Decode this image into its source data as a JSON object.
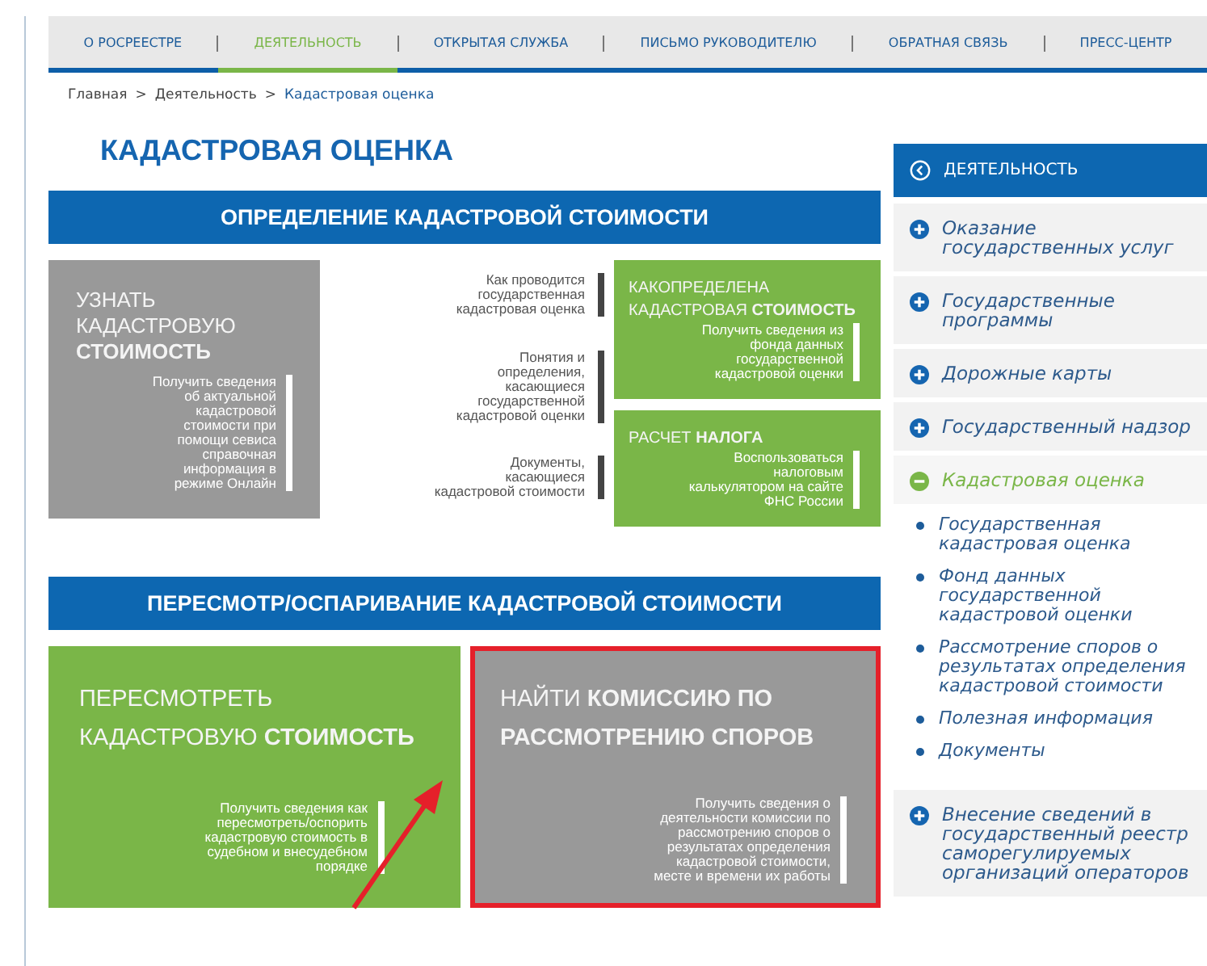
{
  "nav": [
    {
      "label": "О РОСРЕЕСТРЕ",
      "selected": false
    },
    {
      "label": "ДЕЯТЕЛЬНОСТЬ",
      "selected": true
    },
    {
      "label": "ОТКРЫТАЯ СЛУЖБА",
      "selected": false
    },
    {
      "label": "ПИСЬМО РУКОВОДИТЕЛЮ",
      "selected": false
    },
    {
      "label": "ОБРАТНАЯ СВЯЗЬ",
      "selected": false
    },
    {
      "label": "ПРЕСС-ЦЕНТР",
      "selected": false
    }
  ],
  "breadcrumbs": [
    {
      "label": "Главная",
      "current": false
    },
    {
      "label": "Деятельность",
      "current": false
    },
    {
      "label": "Кадастровая оценка",
      "current": true
    }
  ],
  "breadcrumb_separators": [
    ">",
    ">"
  ],
  "page_title": "КАДАСТРОВАЯ ОЦЕНКА",
  "sections": [
    {
      "banner": "ОПРЕДЕЛЕНИЕ КАДАСТРОВОЙ СТОИМОСТИ",
      "cards": [
        {
          "kind": "tile",
          "color": "#999999",
          "highlighted": false,
          "title": [
            "УЗНАТЬ",
            "КАДАСТРОВУЮ",
            "**СТОИМОСТЬ**"
          ],
          "description": "Получить сведения об актуальной кадастровой стоимости при помощи севиса справочная информация в режиме Онлайн"
        },
        {
          "kind": "links",
          "links": [
            "Как проводится государственная кадастровая оценка",
            "Понятия и определения, касающиеся государственной кадастровой оценки",
            "Документы, касающиеся кадастровой стоимости"
          ]
        },
        {
          "kind": "stack",
          "tiles": [
            {
              "kind": "tile",
              "color": "#7ab648",
              "highlighted": false,
              "title": [
                "КАКОПРЕДЕЛЕНА",
                "КАДАСТРОВАЯ **СТОИМОСТЬ**"
              ],
              "description": "Получить сведения из фонда данных государственной кадастровой оценки"
            },
            {
              "kind": "tile",
              "color": "#7ab648",
              "highlighted": false,
              "title": [
                "РАСЧЕТ **НАЛОГА**"
              ],
              "description": "Воспользоваться налоговым калькулятором на сайте ФНС России"
            }
          ]
        }
      ]
    },
    {
      "banner": "ПЕРЕСМОТР/ОСПАРИВАНИЕ КАДАСТРОВОЙ СТОИМОСТИ",
      "cards": [
        {
          "kind": "tile",
          "color": "#7ab648",
          "highlighted": false,
          "title": [
            "ПЕРЕСМОТРЕТЬ",
            "КАДАСТРОВУЮ **СТОИМОСТЬ**"
          ],
          "description": "Получить сведения как пересмотреть/оспорить кадастровую стоимость в судебном и внесудебном порядке"
        },
        {
          "kind": "tile",
          "color": "#999999",
          "highlighted": true,
          "title": [
            "НАЙТИ **КОМИССИЮ ПО**",
            "**РАССМОТРЕНИЮ СПОРОВ**"
          ],
          "description": "Получить сведения о деятельности комиссии по рассмотрению споров о результатах определения кадастровой стоимости, месте и времени их работы"
        }
      ]
    }
  ],
  "sidebar": {
    "header": "ДЕЯТЕЛЬНОСТЬ",
    "items": [
      {
        "label": "Оказание государственных услуг",
        "expanded": false,
        "selected": false
      },
      {
        "label": "Государственные программы",
        "expanded": false,
        "selected": false
      },
      {
        "label": "Дорожные карты",
        "expanded": false,
        "selected": false
      },
      {
        "label": "Государственный надзор",
        "expanded": false,
        "selected": false
      },
      {
        "label": "Кадастровая оценка",
        "expanded": true,
        "selected": true,
        "children": [
          {
            "label": "Государственная кадастровая оценка"
          },
          {
            "label": "Фонд данных государственной кадастровой оценки"
          },
          {
            "label": "Рассмотрение споров о результатах определения кадастровой стоимости"
          },
          {
            "label": "Полезная информация"
          },
          {
            "label": "Документы"
          }
        ]
      },
      {
        "label": "Внесение сведений в государственный реестр саморегулируемых организаций операторов",
        "expanded": false,
        "selected": false
      }
    ]
  }
}
